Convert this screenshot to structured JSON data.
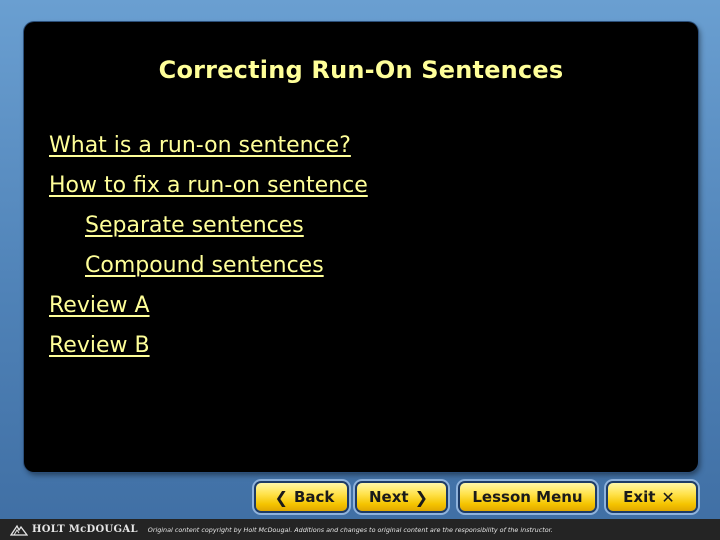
{
  "slide": {
    "title": "Correcting Run-On Sentences",
    "links": [
      {
        "label": "What is a run-on sentence?"
      },
      {
        "label": "How to fix a run-on sentence"
      },
      {
        "label": "Separate sentences"
      },
      {
        "label": "Compound sentences"
      },
      {
        "label": "Review A"
      },
      {
        "label": "Review B"
      }
    ]
  },
  "nav": {
    "back_label": "Back",
    "next_label": "Next",
    "lesson_menu_label": "Lesson Menu",
    "exit_label": "Exit"
  },
  "footer": {
    "brand": "HOLT McDOUGAL",
    "copyright": "Original content copyright by Holt McDougal. Additions and changes to original content are the responsibility of the instructor."
  },
  "colors": {
    "title_text": "#ffff99",
    "link_text": "#ffff99",
    "panel_bg": "#000000",
    "button_gold": "#f5c400",
    "outer_bg": "#4f82b7",
    "footer_bg": "#242424"
  },
  "icons": {
    "back": "chevron-left-icon",
    "next": "chevron-right-icon",
    "exit": "close-icon",
    "brand": "holt-logo-icon"
  }
}
